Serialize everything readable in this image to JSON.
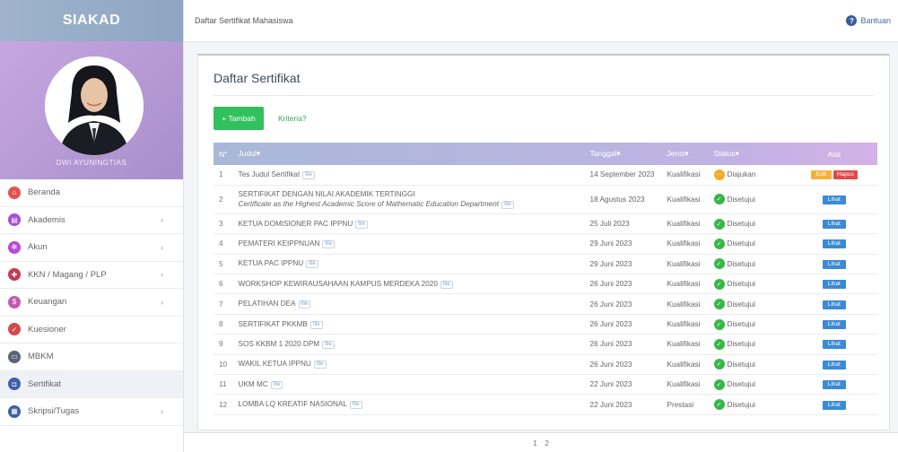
{
  "app": {
    "brand": "SIAKAD"
  },
  "profile": {
    "name": "DWI AYUNINGTIAS"
  },
  "sidebar": {
    "items": [
      {
        "label": "Beranda",
        "icon": "home-icon",
        "color": "#e2534f",
        "glyph": "⌂",
        "chevron": false,
        "active": false
      },
      {
        "label": "Akademis",
        "icon": "book-icon",
        "color": "#a24fd6",
        "glyph": "▤",
        "chevron": true,
        "active": false
      },
      {
        "label": "Akun",
        "icon": "gear-icon",
        "color": "#b84bd2",
        "glyph": "✻",
        "chevron": true,
        "active": false
      },
      {
        "label": "KKN / Magang / PLP",
        "icon": "badge-icon",
        "color": "#c63b56",
        "glyph": "✚",
        "chevron": true,
        "active": false
      },
      {
        "label": "Keuangan",
        "icon": "wallet-icon",
        "color": "#c05cb0",
        "glyph": "$",
        "chevron": true,
        "active": false
      },
      {
        "label": "Kuesioner",
        "icon": "checklist-icon",
        "color": "#d24a4a",
        "glyph": "✓",
        "chevron": false,
        "active": false
      },
      {
        "label": "MBKM",
        "icon": "monitor-icon",
        "color": "#5b6577",
        "glyph": "▭",
        "chevron": false,
        "active": false
      },
      {
        "label": "Sertifikat",
        "icon": "certificate-icon",
        "color": "#3c5fa8",
        "glyph": "◘",
        "chevron": false,
        "active": true
      },
      {
        "label": "Skripsi/Tugas",
        "icon": "document-icon",
        "color": "#3c5fa8",
        "glyph": "▦",
        "chevron": true,
        "active": false
      }
    ]
  },
  "topbar": {
    "breadcrumb": "Daftar Sertifikat Mahasiswa",
    "help": "Bantuan"
  },
  "panel": {
    "title": "Daftar Sertifikat",
    "add_button": "+ Tambah",
    "criteria_link": "Kriteria?"
  },
  "table": {
    "headers": {
      "no": "N°",
      "judul": "Judul",
      "tanggal": "Tanggal",
      "jenis": "Jenis",
      "status": "Status",
      "alat": "Alat"
    },
    "rows": [
      {
        "no": "1",
        "title": "Tes Judul Sertifikat",
        "subtitle": "",
        "date": "14 September 2023",
        "type": "Kualifikasi",
        "status": "Diajukan",
        "state": "pending"
      },
      {
        "no": "2",
        "title": "SERTIFIKAT DENGAN NILAI AKADEMIK TERTINGGI",
        "subtitle": "Certificate as the Highest Academic Score of Mathematic Education Department",
        "date": "18 Agustus 2023",
        "type": "Kualifikasi",
        "status": "Disetujui",
        "state": "ok"
      },
      {
        "no": "3",
        "title": "KETUA DOMISIONER PAC IPPNU",
        "subtitle": "",
        "date": "25 Juli 2023",
        "type": "Kualifikasi",
        "status": "Disetujui",
        "state": "ok"
      },
      {
        "no": "4",
        "title": "PEMATERI KEIPPNUAN",
        "subtitle": "",
        "date": "29 Juni 2023",
        "type": "Kualifikasi",
        "status": "Disetujui",
        "state": "ok"
      },
      {
        "no": "5",
        "title": "KETUA PAC IPPNU",
        "subtitle": "",
        "date": "29 Juni 2023",
        "type": "Kualifikasi",
        "status": "Disetujui",
        "state": "ok"
      },
      {
        "no": "6",
        "title": "WORKSHOP KEWIRAUSAHAAN KAMPUS MERDEKA 2020",
        "subtitle": "",
        "date": "26 Juni 2023",
        "type": "Kualifikasi",
        "status": "Disetujui",
        "state": "ok"
      },
      {
        "no": "7",
        "title": "PELATIHAN DEA",
        "subtitle": "",
        "date": "26 Juni 2023",
        "type": "Kualifikasi",
        "status": "Disetujui",
        "state": "ok"
      },
      {
        "no": "8",
        "title": "SERTIFIKAT PKKMB",
        "subtitle": "",
        "date": "26 Juni 2023",
        "type": "Kualifikasi",
        "status": "Disetujui",
        "state": "ok"
      },
      {
        "no": "9",
        "title": "SOS KKBM 1 2020 DPM",
        "subtitle": "",
        "date": "26 Juni 2023",
        "type": "Kualifikasi",
        "status": "Disetujui",
        "state": "ok"
      },
      {
        "no": "10",
        "title": "WAKIL KETUA IPPNU",
        "subtitle": "",
        "date": "26 Juni 2023",
        "type": "Kualifikasi",
        "status": "Disetujui",
        "state": "ok"
      },
      {
        "no": "11",
        "title": "UKM MC",
        "subtitle": "",
        "date": "22 Juni 2023",
        "type": "Kualifikasi",
        "status": "Disetujui",
        "state": "ok"
      },
      {
        "no": "12",
        "title": "LOMBA LQ KREATIF NASIONAL",
        "subtitle": "",
        "date": "22 Juni 2023",
        "type": "Prestasi",
        "status": "Disetujui",
        "state": "ok"
      }
    ],
    "actions": {
      "view": "Lihat",
      "edit": "Edit",
      "delete": "Hapus",
      "file_tag": "file"
    }
  },
  "pagination": {
    "pages": [
      "1",
      "2"
    ]
  },
  "colors": {
    "accent_green": "#32c05e",
    "status_ok": "#38b749",
    "status_pending": "#f0ad2a",
    "view_button": "#3b8ad6",
    "delete_button": "#e04a4a"
  }
}
